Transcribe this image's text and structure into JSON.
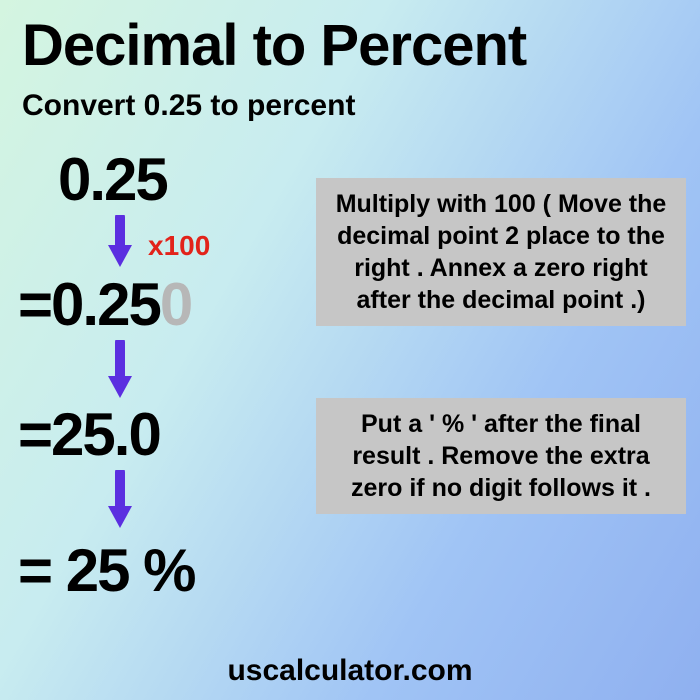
{
  "title": "Decimal to Percent",
  "subtitle": "Convert 0.25 to percent",
  "steps": {
    "line1": "0.25",
    "line2_prefix": "=0.25",
    "line2_ghost": "0",
    "line3": "=25.0",
    "line4": "= 25 %"
  },
  "multiplier_label": "x100",
  "explain1": "Multiply with 100 ( Move the decimal point 2 place to the right . Annex a zero right after the decimal point .)",
  "explain2": "Put a ' % ' after the final result . Remove the extra zero if no digit follows it .",
  "footer": "uscalculator.com",
  "colors": {
    "arrow": "#5b2fe0",
    "multiplier": "#e2231a",
    "ghost": "#b7b7b7"
  }
}
